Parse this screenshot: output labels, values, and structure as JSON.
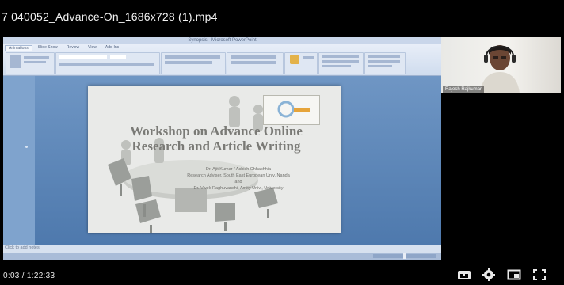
{
  "video": {
    "title": "7 040052_Advance-On_1686x728 (1).mp4",
    "time_display": "0:03 / 1:22:33"
  },
  "powerpoint": {
    "window_title": "Synopsis - Microsoft PowerPoint",
    "tabs": [
      "Animations",
      "Slide Show",
      "Review",
      "View",
      "Add-Ins"
    ],
    "notes_placeholder": "Click to add notes",
    "zoom_label": "",
    "slide": {
      "title": "Workshop on Advance Online Research and Article Writing",
      "lines": [
        "Dr. Ajit Kumar / Ashish Chhachhia",
        "Research Adviser, South East European Univ. Nanda",
        "and",
        "Dr. Vivek Raghuvanshi, Amity Univ., University"
      ]
    }
  },
  "webcam": {
    "participant_name": "Rajesh Rajkumar"
  },
  "controls": {
    "icons": [
      "subtitles-icon",
      "settings-icon",
      "miniplayer-icon",
      "fullscreen-icon"
    ]
  },
  "colors": {
    "background": "#000000",
    "ppt_frame": "#5d87b8",
    "slide_bg": "#e9eae8",
    "title_text": "#f2f2f2"
  }
}
